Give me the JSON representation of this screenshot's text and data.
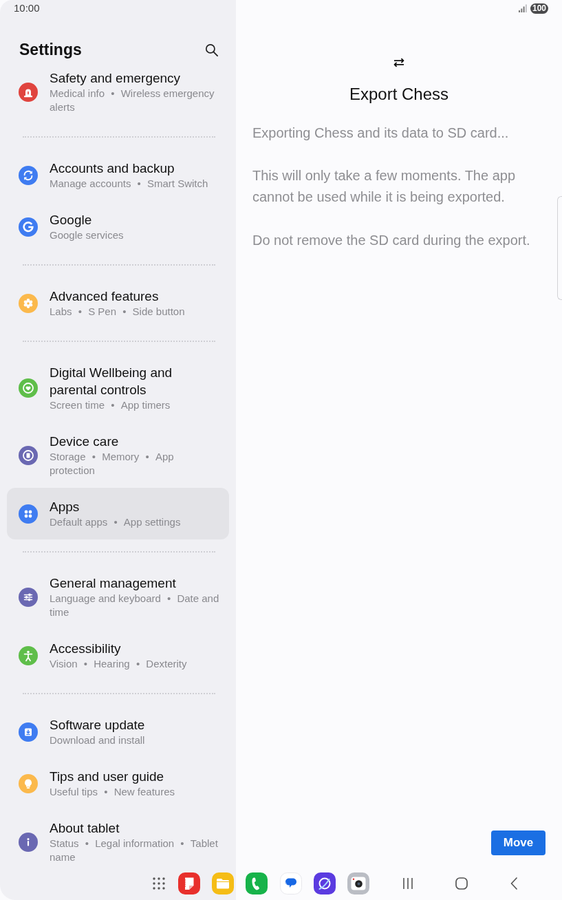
{
  "status_bar": {
    "time": "10:00",
    "battery": "100"
  },
  "settings": {
    "title": "Settings",
    "groups": [
      {
        "items": [
          {
            "title": "Safety and emergency",
            "subtitle": "Medical info • Wireless emergency alerts",
            "color": "#e0443e",
            "selected": false
          }
        ]
      },
      {
        "items": [
          {
            "title": "Accounts and backup",
            "subtitle": "Manage accounts • Smart Switch",
            "color": "#3f7cf1",
            "selected": false
          },
          {
            "title": "Google",
            "subtitle": "Google services",
            "color": "#3f7cf1",
            "selected": false
          }
        ]
      },
      {
        "items": [
          {
            "title": "Advanced features",
            "subtitle": "Labs • S Pen • Side button",
            "color": "#fbb94c",
            "selected": false
          }
        ]
      },
      {
        "items": [
          {
            "title": "Digital Wellbeing and parental controls",
            "subtitle": "Screen time • App timers",
            "color": "#5fbe4a",
            "selected": false
          },
          {
            "title": "Device care",
            "subtitle": "Storage • Memory • App protection",
            "color": "#6a68b2",
            "selected": false
          },
          {
            "title": "Apps",
            "subtitle": "Default apps • App settings",
            "color": "#3f7cf1",
            "selected": true
          }
        ]
      },
      {
        "items": [
          {
            "title": "General management",
            "subtitle": "Language and keyboard • Date and time",
            "color": "#6a68b2",
            "selected": false
          },
          {
            "title": "Accessibility",
            "subtitle": "Vision • Hearing • Dexterity",
            "color": "#5fbe4a",
            "selected": false
          }
        ]
      },
      {
        "items": [
          {
            "title": "Software update",
            "subtitle": "Download and install",
            "color": "#3f7cf1",
            "selected": false
          },
          {
            "title": "Tips and user guide",
            "subtitle": "Useful tips • New features",
            "color": "#fbb94c",
            "selected": false
          },
          {
            "title": "About tablet",
            "subtitle": "Status • Legal information • Tablet name",
            "color": "#6a68b2",
            "selected": false
          }
        ]
      }
    ]
  },
  "dialog": {
    "title": "Export Chess",
    "paragraphs": [
      "Exporting Chess and its data to SD card...",
      "This will only take a few moments. The app cannot be used while it is being exported.",
      "Do not remove the SD card during the export."
    ],
    "button": "Move"
  }
}
